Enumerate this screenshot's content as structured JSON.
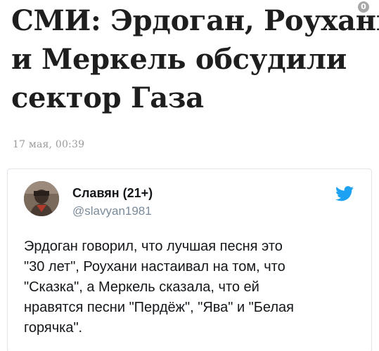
{
  "article": {
    "headline_lines": [
      "СМИ: Эрдоган, Роухани",
      "и Меркель обсудили",
      "сектор Газа"
    ],
    "timestamp": "17 мая, 00:39",
    "badge_glyph": "0"
  },
  "tweet": {
    "author_name": "Славян (21+)",
    "author_handle": "@slavyan1981",
    "text_lines": [
      "Эрдоган говорил, что лучшая песня это",
      "\"30 лет\", Роухани настаивал на том, что",
      "\"Сказка\", а Меркель сказала, что ей",
      "нравятся песни \"Пердёж\", \"Ява\" и \"Белая",
      "горячка\"."
    ],
    "brand_color": "#1da1f2"
  }
}
